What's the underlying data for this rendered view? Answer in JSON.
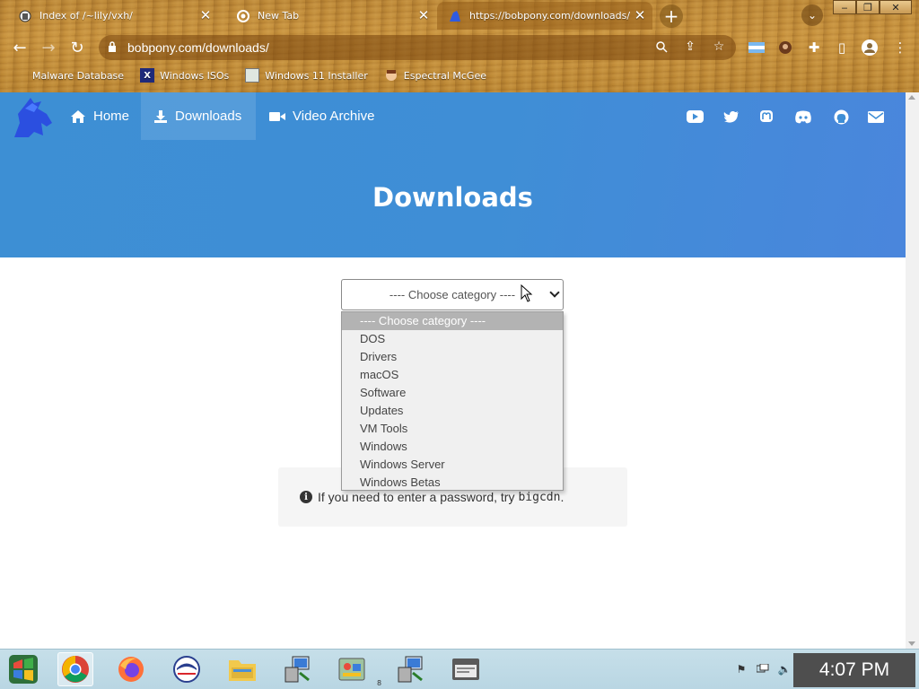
{
  "browser": {
    "tabs": [
      {
        "title": "Index of /~lily/vxh/",
        "favicon": "trash-icon"
      },
      {
        "title": "New Tab",
        "favicon": "chrome-icon"
      },
      {
        "title": "https://bobpony.com/downloads/",
        "favicon": "bobpony-icon"
      }
    ],
    "new_tab_label": "+",
    "address": "bobpony.com/downloads/",
    "bookmarks": [
      {
        "label": "Malware Database",
        "icon": "malware-icon"
      },
      {
        "label": "Windows ISOs",
        "icon": "x-icon"
      },
      {
        "label": "Windows 11 Installer",
        "icon": "installer-icon"
      },
      {
        "label": "Espectral McGee",
        "icon": "avatar-icon"
      }
    ]
  },
  "site": {
    "nav": [
      {
        "label": "Home",
        "icon": "home-icon"
      },
      {
        "label": "Downloads",
        "icon": "download-icon"
      },
      {
        "label": "Video Archive",
        "icon": "video-icon"
      }
    ],
    "social": [
      "youtube-icon",
      "twitter-icon",
      "mastodon-icon",
      "discord-icon",
      "github-icon",
      "mail-icon"
    ],
    "title": "Downloads",
    "select": {
      "value": "---- Choose category ----",
      "options": [
        "---- Choose category ----",
        "DOS",
        "Drivers",
        "macOS",
        "Software",
        "Updates",
        "VM Tools",
        "Windows",
        "Windows Server",
        "Windows Betas"
      ]
    },
    "notice": {
      "text": "If you need to enter a password, try",
      "code": "bigcdn",
      "suffix": "."
    }
  },
  "taskbar": {
    "clock": "4:07 PM",
    "badge": "8"
  },
  "colors": {
    "hero": "#3f8ed6",
    "wood": "#c58f3a",
    "taskbar": "#c6dfe9",
    "clock_bg": "#4e4e4e"
  }
}
